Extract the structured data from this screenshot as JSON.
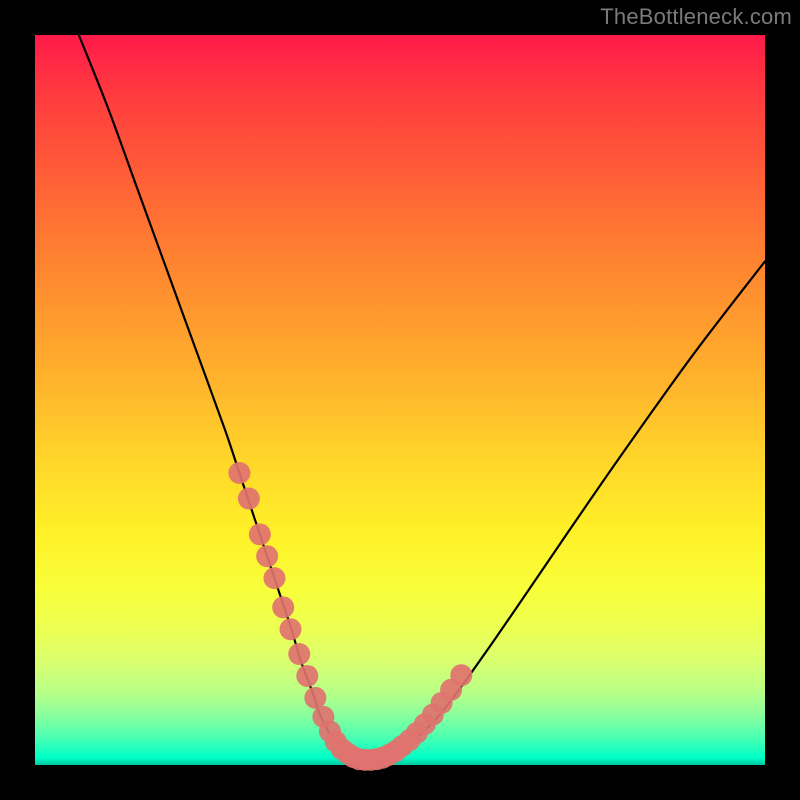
{
  "watermark": {
    "text": "TheBottleneck.com"
  },
  "colors": {
    "curve": "#000000",
    "marker_fill": "#e0736f",
    "marker_stroke": "#e0736f",
    "frame_bg": "#000000"
  },
  "chart_data": {
    "type": "line",
    "title": "",
    "xlabel": "",
    "ylabel": "",
    "xlim": [
      0,
      100
    ],
    "ylim": [
      0,
      100
    ],
    "grid": false,
    "legend": false,
    "series": [
      {
        "name": "bottleneck-curve",
        "x": [
          6,
          10,
          14,
          18,
          22,
          26,
          28,
          30,
          32,
          33.5,
          35,
          36.5,
          38,
          39,
          40,
          41,
          42,
          43,
          44,
          46,
          48,
          50,
          52,
          55,
          58,
          62,
          66,
          72,
          80,
          90,
          100
        ],
        "y": [
          100,
          90,
          79,
          68,
          57,
          46,
          40,
          34,
          28,
          23.5,
          19,
          14,
          10,
          7,
          5,
          3.2,
          2,
          1.2,
          0.8,
          0.6,
          0.8,
          1.8,
          3.4,
          6.4,
          10.2,
          15.8,
          21.6,
          30.4,
          42,
          56,
          69
        ]
      }
    ],
    "markers": {
      "name": "highlighted-points",
      "x": [
        28,
        29.3,
        30.8,
        31.8,
        32.8,
        34,
        35,
        36.2,
        37.3,
        38.4,
        39.5,
        40.4,
        41.2,
        42,
        42.8,
        43.6,
        44.4,
        45.2,
        46,
        46.8,
        47.6,
        48.5,
        49.4,
        50.3,
        51.3,
        52.3,
        53.4,
        54.5,
        55.7,
        57,
        58.4
      ],
      "y": [
        40,
        36.5,
        31.6,
        28.6,
        25.6,
        21.6,
        18.6,
        15.2,
        12.2,
        9.2,
        6.6,
        4.6,
        3.2,
        2.2,
        1.6,
        1.1,
        0.8,
        0.7,
        0.7,
        0.8,
        1.0,
        1.4,
        1.9,
        2.6,
        3.4,
        4.4,
        5.6,
        6.9,
        8.5,
        10.3,
        12.3
      ],
      "r": 11
    }
  }
}
